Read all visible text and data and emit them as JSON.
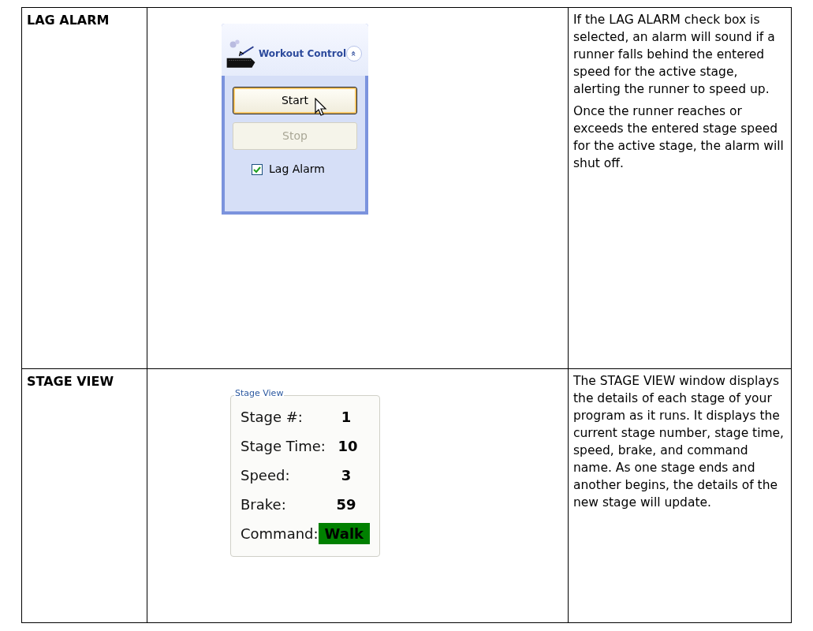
{
  "rows": [
    {
      "heading": "LAG ALARM",
      "panel": {
        "kind": "workout_control",
        "title": "Workout Control",
        "collapse_glyph": "«",
        "buttons": [
          {
            "label": "Start",
            "disabled": false,
            "hovered": true
          },
          {
            "label": "Stop",
            "disabled": true,
            "hovered": false
          }
        ],
        "checkbox": {
          "label": "Lag Alarm",
          "checked": true
        }
      },
      "description": [
        "If the LAG ALARM check box is selected, an alarm will sound if a runner falls behind the entered speed for the active stage, alerting the runner to speed up.",
        "Once the runner reaches or exceeds the entered stage speed for the active stage, the alarm will shut off."
      ]
    },
    {
      "heading": "STAGE VIEW",
      "panel": {
        "kind": "stage_view",
        "title": "Stage View",
        "fields": [
          {
            "label": "Stage #:",
            "value": "1",
            "highlight": false
          },
          {
            "label": "Stage Time:",
            "value": "10",
            "highlight": false
          },
          {
            "label": "Speed:",
            "value": "3",
            "highlight": false
          },
          {
            "label": "Brake:",
            "value": "59",
            "highlight": false
          },
          {
            "label": "Command:",
            "value": "Walk",
            "highlight": true
          }
        ]
      },
      "description": [
        "The STAGE VIEW window displays the details of each stage of your program as it runs.  It displays the current stage number, stage time, speed, brake, and command name.  As one stage ends and another begins, the details of the new stage will update."
      ]
    }
  ]
}
